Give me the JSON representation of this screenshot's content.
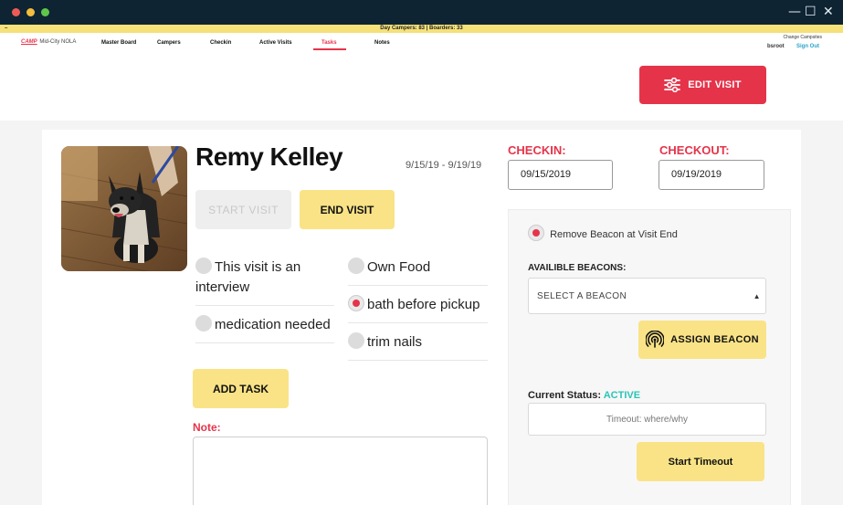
{
  "window": {
    "minimize_glyph": "—",
    "maximize_glyph": "☐",
    "close_glyph": "✕"
  },
  "infobar": {
    "left_mark": "–",
    "text": "Day Campers: 83 | Boarders: 33"
  },
  "nav": {
    "logo_brand": "CAMP",
    "logo_location": "Mid-City NOLA",
    "items": [
      {
        "label": "Master Board"
      },
      {
        "label": "Campers"
      },
      {
        "label": "Checkin"
      },
      {
        "label": "Active Visits"
      },
      {
        "label": "Tasks"
      },
      {
        "label": "Notes"
      }
    ],
    "active_item": "Tasks",
    "change_campsites": "Change Campsites",
    "username": "bsroot",
    "signout": "Sign Out"
  },
  "header": {
    "edit_visit_label": "EDIT VISIT"
  },
  "visit": {
    "name": "Remy Kelley",
    "date_range": "9/15/19 - 9/19/19",
    "start_visit_label": "START VISIT",
    "end_visit_label": "END VISIT",
    "tasks": [
      {
        "label": "This visit is an interview",
        "checked": false
      },
      {
        "label": "medication needed",
        "checked": false
      },
      {
        "label": "Own Food",
        "checked": false
      },
      {
        "label": "bath before pickup",
        "checked": true
      },
      {
        "label": "trim nails",
        "checked": false
      }
    ],
    "add_task_label": "ADD TASK",
    "note_label": "Note:",
    "note_value": ""
  },
  "checkin": {
    "checkin_label": "CHECKIN:",
    "checkin_value": "09/15/2019",
    "checkout_label": "CHECKOUT:",
    "checkout_value": "09/19/2019"
  },
  "beacon": {
    "remove_label": "Remove Beacon at Visit End",
    "remove_checked": true,
    "available_label": "AVAILIBLE BEACONS:",
    "select_value": "SELECT A BEACON",
    "assign_label": "ASSIGN BEACON",
    "status_label": "Current Status:",
    "status_value": "ACTIVE",
    "timeout_placeholder": "Timeout: where/why",
    "start_timeout_label": "Start Timeout"
  },
  "colors": {
    "accent_red": "#e5344a",
    "yellow": "#f9e386",
    "status_teal": "#2cc4b8",
    "titlebar": "#0e2433"
  }
}
